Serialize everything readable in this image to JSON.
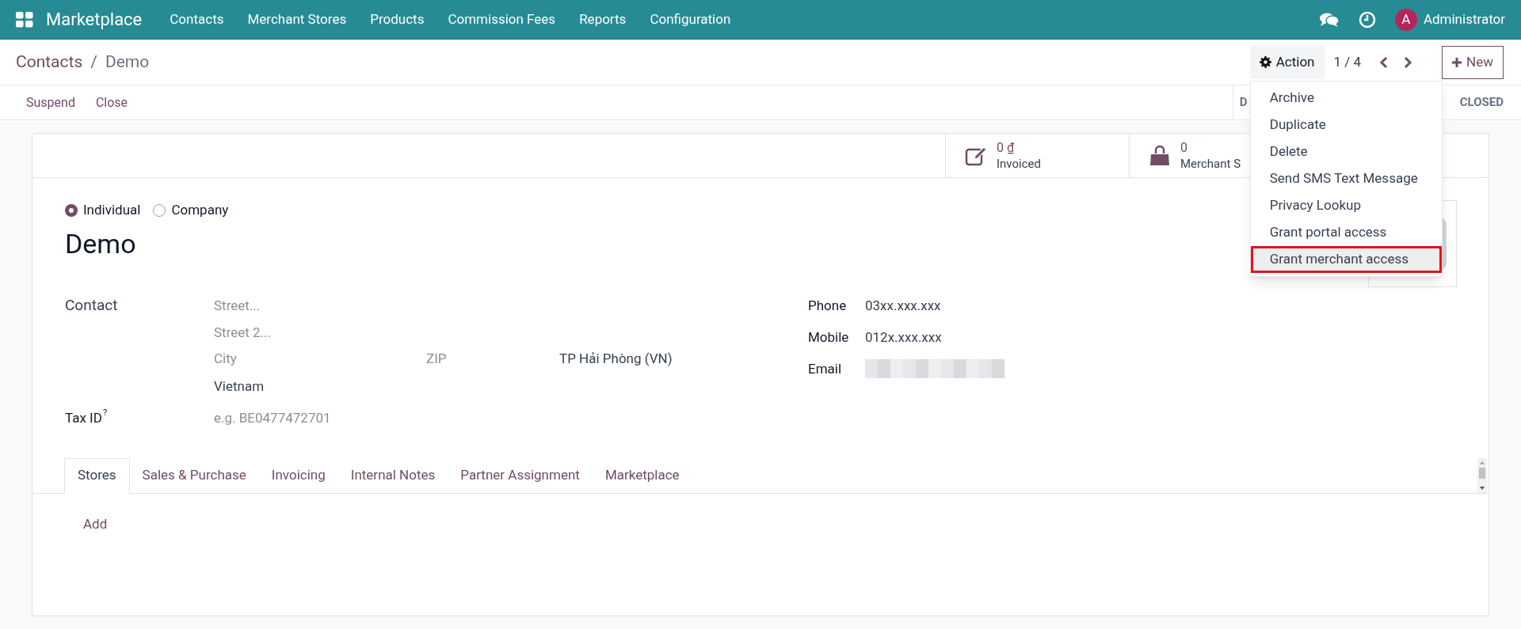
{
  "navbar": {
    "app": "Marketplace",
    "menu": [
      "Contacts",
      "Merchant Stores",
      "Products",
      "Commission Fees",
      "Reports",
      "Configuration"
    ],
    "user": {
      "initial": "A",
      "name": "Administrator"
    }
  },
  "breadcrumb": {
    "parent": "Contacts",
    "separator": "/",
    "current": "Demo"
  },
  "action_button": "Action",
  "pager": "1 / 4",
  "new_button": "New",
  "action_menu": [
    {
      "label": "Archive",
      "highlighted": false
    },
    {
      "label": "Duplicate",
      "highlighted": false
    },
    {
      "label": "Delete",
      "highlighted": false
    },
    {
      "label": "Send SMS Text Message",
      "highlighted": false
    },
    {
      "label": "Privacy Lookup",
      "highlighted": false
    },
    {
      "label": "Grant portal access",
      "highlighted": false
    },
    {
      "label": "Grant merchant access",
      "highlighted": true
    }
  ],
  "status_buttons": [
    "Suspend",
    "Close"
  ],
  "stages": [
    "D",
    "CLOSED"
  ],
  "smart_buttons": [
    {
      "kind": "invoice",
      "value": "0 ₫",
      "label": "Invoiced"
    },
    {
      "kind": "bag",
      "value": "0",
      "label": "Merchant S"
    }
  ],
  "company_type": [
    {
      "label": "Individual",
      "selected": true
    },
    {
      "label": "Company",
      "selected": false
    }
  ],
  "name": "Demo",
  "address": {
    "label": "Contact",
    "street": {
      "placeholder": "Street..."
    },
    "street2": {
      "placeholder": "Street 2..."
    },
    "city": {
      "placeholder": "City"
    },
    "zip": {
      "placeholder": "ZIP"
    },
    "state": "TP Hải Phòng (VN)",
    "country": "Vietnam"
  },
  "tax_id": {
    "label": "Tax ID",
    "hint": "?",
    "placeholder": "e.g. BE0477472701"
  },
  "contact_fields": [
    {
      "kind": "text",
      "label": "Phone",
      "value": "03xx.xxx.xxx"
    },
    {
      "kind": "text",
      "label": "Mobile",
      "value": "012x.xxx.xxx"
    },
    {
      "kind": "blurred",
      "label": "Email"
    }
  ],
  "tabs": [
    {
      "label": "Stores",
      "selected": true
    },
    {
      "label": "Sales & Purchase",
      "selected": false
    },
    {
      "label": "Invoicing",
      "selected": false
    },
    {
      "label": "Internal Notes",
      "selected": false
    },
    {
      "label": "Partner Assignment",
      "selected": false
    },
    {
      "label": "Marketplace",
      "selected": false
    }
  ],
  "add_link": "Add"
}
